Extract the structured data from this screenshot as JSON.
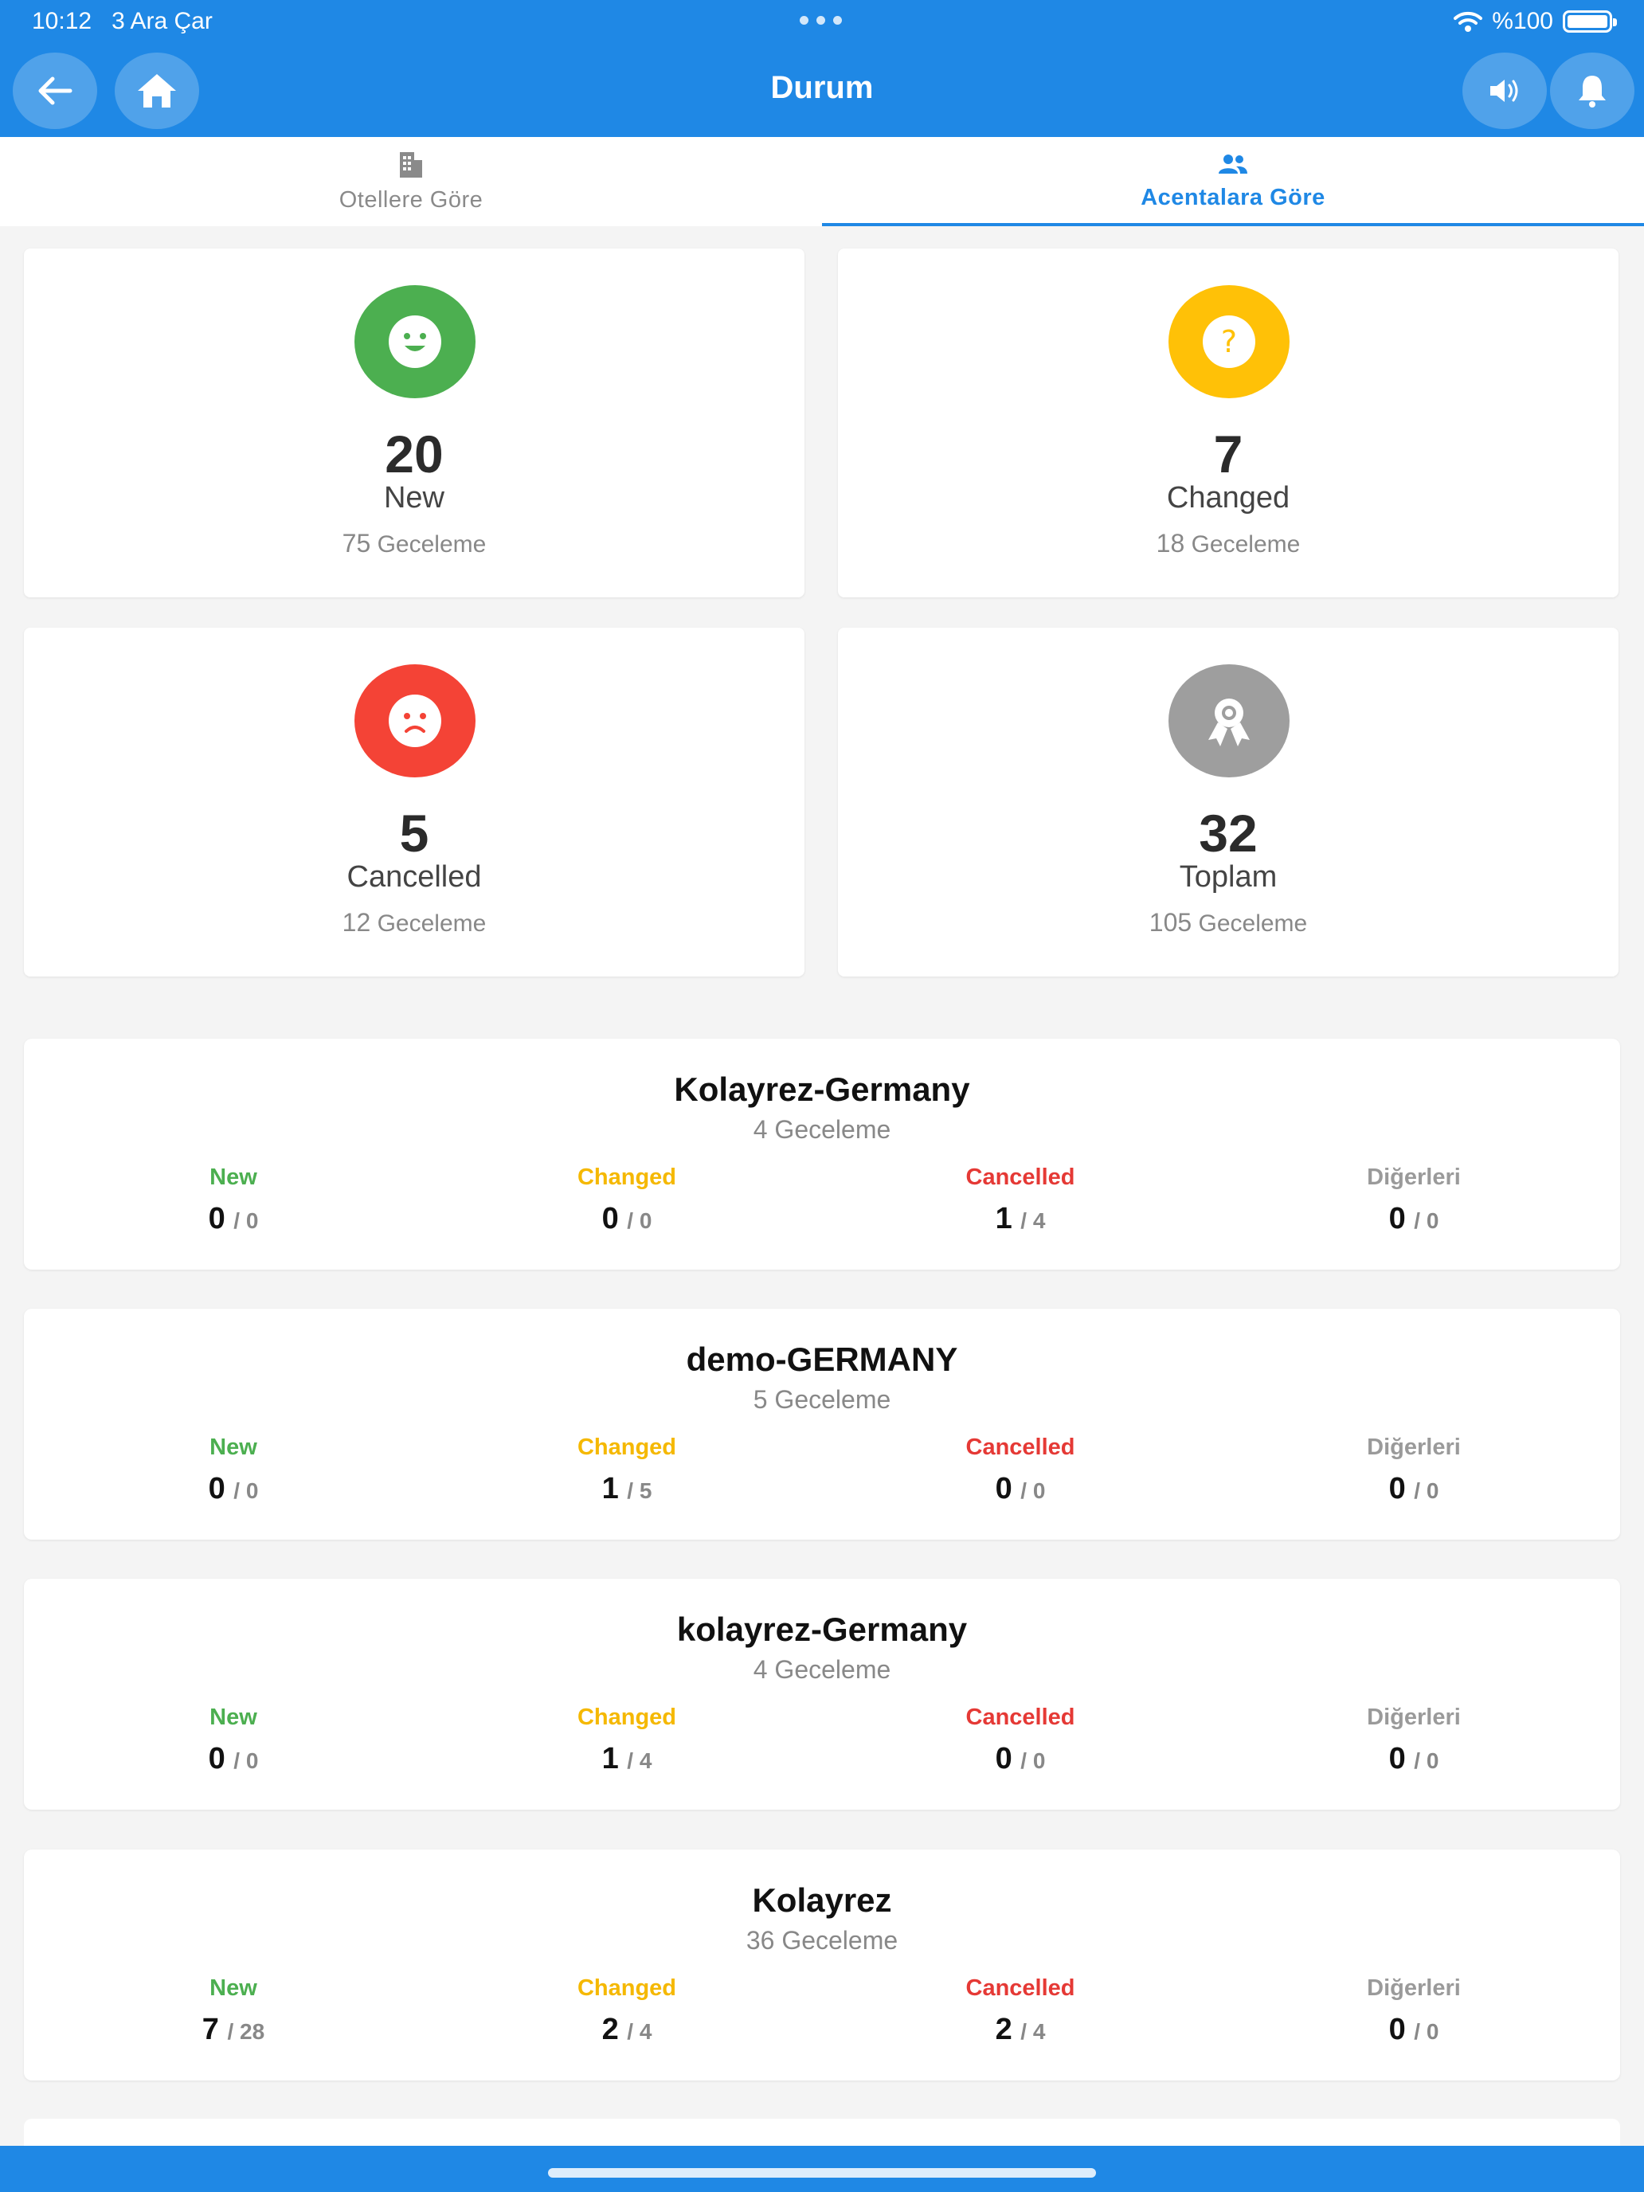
{
  "status_bar": {
    "time": "10:12",
    "date": "3 Ara Çar",
    "battery": "%100"
  },
  "header": {
    "title": "Durum"
  },
  "tabs": [
    {
      "label": "Otellere Göre",
      "icon": "building-icon",
      "active": false
    },
    {
      "label": "Acentalara Göre",
      "icon": "users-icon",
      "active": true
    }
  ],
  "summary": [
    {
      "count": "20",
      "label": "New",
      "nights": "75",
      "nights_label": "Geceleme",
      "color": "#4caf50",
      "icon": "smile-icon"
    },
    {
      "count": "7",
      "label": "Changed",
      "nights": "18",
      "nights_label": "Geceleme",
      "color": "#ffc107",
      "icon": "question-icon"
    },
    {
      "count": "5",
      "label": "Cancelled",
      "nights": "12",
      "nights_label": "Geceleme",
      "color": "#f44336",
      "icon": "sad-icon"
    },
    {
      "count": "32",
      "label": "Toplam",
      "nights": "105",
      "nights_label": "Geceleme",
      "color": "#9e9e9e",
      "icon": "award-icon"
    }
  ],
  "column_labels": {
    "new": "New",
    "changed": "Changed",
    "cancelled": "Cancelled",
    "others": "Diğerleri"
  },
  "agencies": [
    {
      "name": "Kolayrez-Germany",
      "nights": "4 Geceleme",
      "new": {
        "v": "0",
        "t": "/ 0"
      },
      "changed": {
        "v": "0",
        "t": "/ 0"
      },
      "cancelled": {
        "v": "1",
        "t": "/ 4"
      },
      "others": {
        "v": "0",
        "t": "/ 0"
      }
    },
    {
      "name": "demo-GERMANY",
      "nights": "5 Geceleme",
      "new": {
        "v": "0",
        "t": "/ 0"
      },
      "changed": {
        "v": "1",
        "t": "/ 5"
      },
      "cancelled": {
        "v": "0",
        "t": "/ 0"
      },
      "others": {
        "v": "0",
        "t": "/ 0"
      }
    },
    {
      "name": "kolayrez-Germany",
      "nights": "4 Geceleme",
      "new": {
        "v": "0",
        "t": "/ 0"
      },
      "changed": {
        "v": "1",
        "t": "/ 4"
      },
      "cancelled": {
        "v": "0",
        "t": "/ 0"
      },
      "others": {
        "v": "0",
        "t": "/ 0"
      }
    },
    {
      "name": "Kolayrez",
      "nights": "36 Geceleme",
      "new": {
        "v": "7",
        "t": "/ 28"
      },
      "changed": {
        "v": "2",
        "t": "/ 4"
      },
      "cancelled": {
        "v": "2",
        "t": "/ 4"
      },
      "others": {
        "v": "0",
        "t": "/ 0"
      }
    }
  ]
}
